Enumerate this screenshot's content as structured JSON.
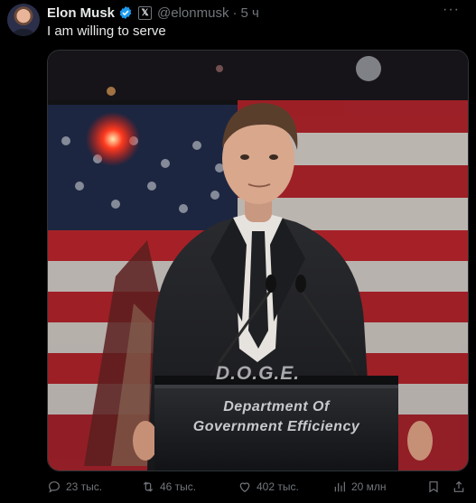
{
  "tweet": {
    "author_name": "Elon Musk",
    "handle": "@elonmusk",
    "separator": "·",
    "time": "5 ч",
    "more": "···",
    "text": "I am willing to serve"
  },
  "image": {
    "podium_sign": "D.O.G.E.",
    "podium_line1": "Department Of",
    "podium_line2": "Government Efficiency"
  },
  "actions": {
    "replies": "23 тыс.",
    "reposts": "46 тыс.",
    "likes": "402 тыс.",
    "views": "20 млн"
  },
  "colors": {
    "background": "#000000",
    "text_primary": "#e7e9ea",
    "text_secondary": "#71767b",
    "verified_blue": "#1d9bf0"
  },
  "icons": [
    "verified-badge-icon",
    "x-affiliate-icon",
    "more-icon",
    "reply-icon",
    "repost-icon",
    "like-icon",
    "views-icon",
    "bookmark-icon",
    "share-icon"
  ]
}
